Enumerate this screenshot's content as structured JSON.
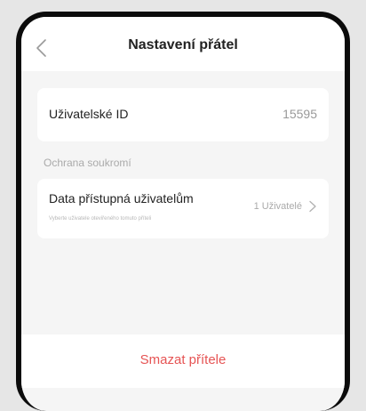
{
  "header": {
    "title": "Nastavení přátel"
  },
  "user_id": {
    "label": "Uživatelské ID",
    "value": "15595"
  },
  "privacy": {
    "section_label": "Ochrana soukromí",
    "data_access": {
      "label": "Data přístupná uživatelům",
      "description": "Vyberte uživatele oteviřeného tomuto příteli",
      "value": "1 Uživatelé"
    }
  },
  "actions": {
    "delete_label": "Smazat přítele"
  },
  "colors": {
    "delete": "#e65454",
    "background": "#f5f5f5",
    "frame": "#0b0b0b"
  },
  "icons": {
    "back": "chevron-left-icon",
    "disclosure": "chevron-right-icon"
  }
}
